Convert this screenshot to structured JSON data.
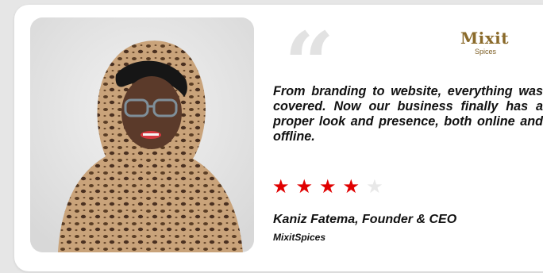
{
  "testimonial": {
    "photo_icon": "person-portrait",
    "quote_icon": "open-quote-icon",
    "quote_mark": "“",
    "logo": {
      "word": "Mixit",
      "sub": "Spices"
    },
    "text": "From branding to website, everything was covered. Now our business finally has a proper look and presence, both online and offline.",
    "rating": {
      "value": 4,
      "max": 5,
      "star_glyph": "★"
    },
    "author": "Kaniz Fatema, Founder & CEO",
    "company": "MixitSpices"
  },
  "colors": {
    "star_filled": "#e00000",
    "star_empty": "#e8e8e8",
    "logo_brown": "#8a6a2a",
    "quote_gray": "#e2e2e2"
  }
}
